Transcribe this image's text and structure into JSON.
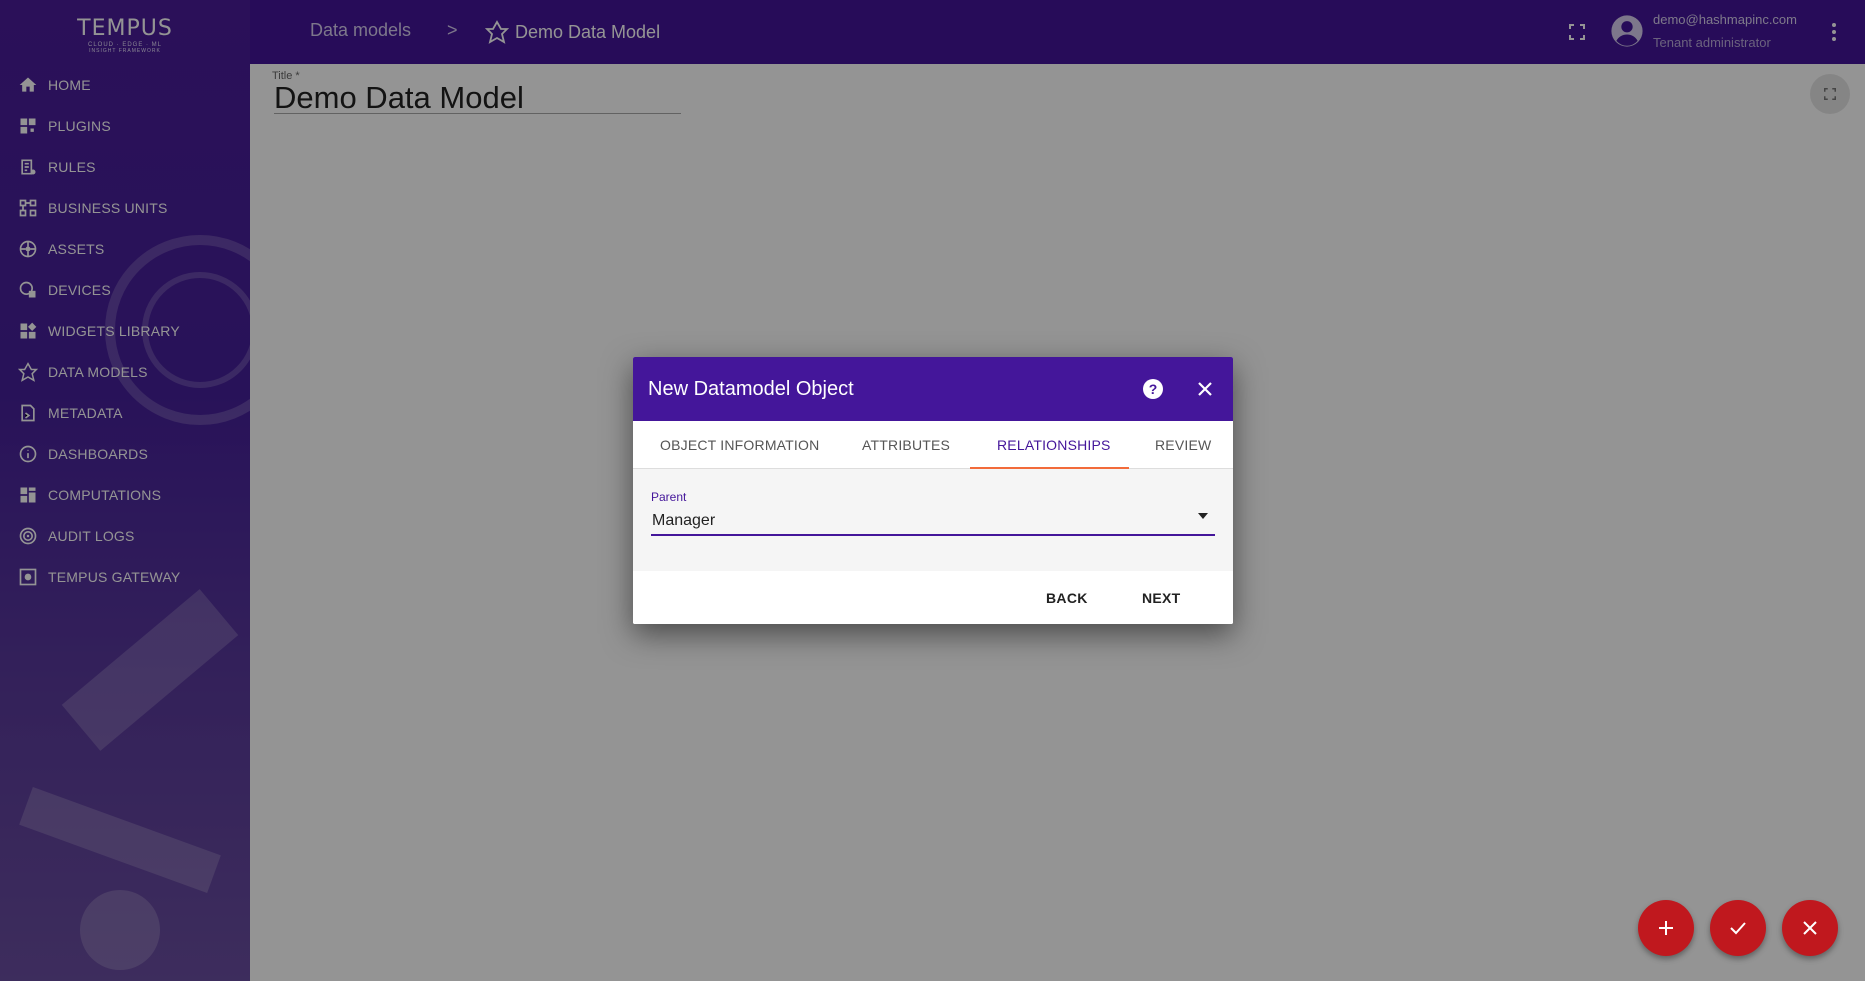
{
  "brand": {
    "name": "TEMPUS",
    "tagline": "CLOUD · EDGE · ML",
    "sub": "INSIGHT FRAMEWORK"
  },
  "sidebar": {
    "items": [
      {
        "label": "HOME",
        "icon": "home-icon"
      },
      {
        "label": "PLUGINS",
        "icon": "plugin-icon"
      },
      {
        "label": "RULES",
        "icon": "rules-icon"
      },
      {
        "label": "BUSINESS UNITS",
        "icon": "business-units-icon"
      },
      {
        "label": "ASSETS",
        "icon": "assets-icon"
      },
      {
        "label": "DEVICES",
        "icon": "devices-icon"
      },
      {
        "label": "WIDGETS LIBRARY",
        "icon": "widgets-icon"
      },
      {
        "label": "DATA MODELS",
        "icon": "data-models-icon"
      },
      {
        "label": "METADATA",
        "icon": "metadata-icon"
      },
      {
        "label": "DASHBOARDS",
        "icon": "dashboards-icon"
      },
      {
        "label": "COMPUTATIONS",
        "icon": "computations-icon"
      },
      {
        "label": "AUDIT LOGS",
        "icon": "audit-logs-icon"
      },
      {
        "label": "TEMPUS GATEWAY",
        "icon": "gateway-icon"
      }
    ]
  },
  "header": {
    "breadcrumb": {
      "parent": "Data models",
      "separator": ">",
      "current": "Demo Data Model"
    },
    "user": {
      "email": "demo@hashmapinc.com",
      "role": "Tenant administrator"
    }
  },
  "main": {
    "title_label": "Title *",
    "title_value": "Demo Data Model"
  },
  "dialog": {
    "title": "New Datamodel Object",
    "tabs": [
      "OBJECT INFORMATION",
      "ATTRIBUTES",
      "RELATIONSHIPS",
      "REVIEW"
    ],
    "active_tab": "RELATIONSHIPS",
    "field": {
      "label": "Parent",
      "value": "Manager"
    },
    "actions": {
      "back": "BACK",
      "next": "NEXT"
    }
  },
  "colors": {
    "primary": "#44169a",
    "accent": "#f26b3a",
    "fab": "#c0181e"
  }
}
